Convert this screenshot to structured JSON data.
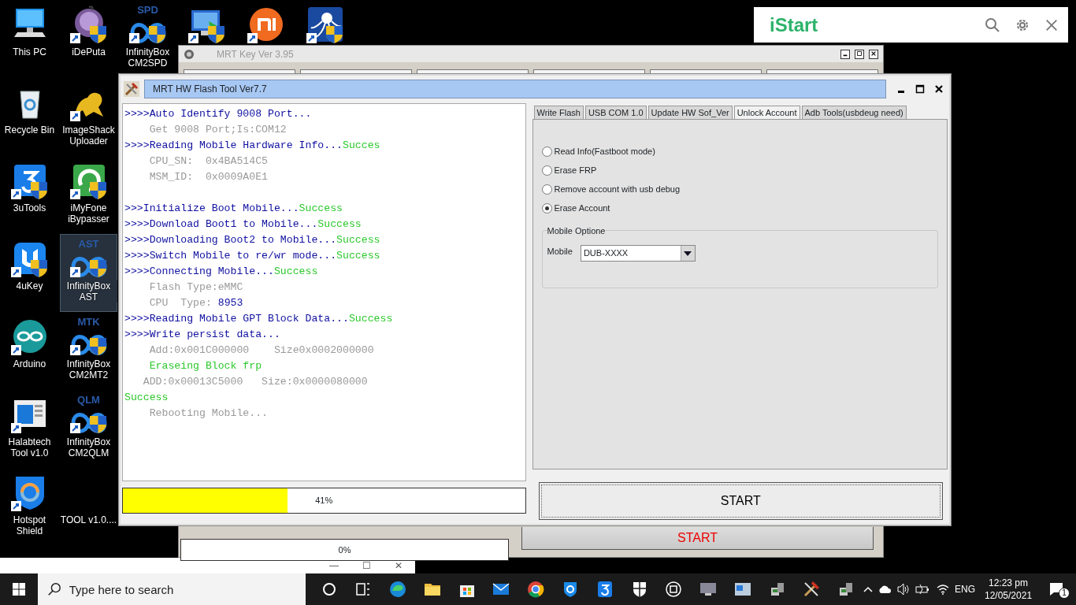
{
  "desktop": {
    "columns": [
      [
        {
          "label": "This PC",
          "kind": "pc",
          "shortcut": false,
          "shield": false,
          "selected": false
        },
        {
          "label": "Recycle Bin",
          "kind": "bin",
          "shortcut": false,
          "shield": false,
          "selected": false
        },
        {
          "label": "3uTools",
          "kind": "three",
          "shortcut": true,
          "shield": true,
          "selected": false
        },
        {
          "label": "4uKey",
          "kind": "key",
          "shortcut": true,
          "shield": true,
          "selected": false
        },
        {
          "label": "Arduino",
          "kind": "arduino",
          "shortcut": true,
          "shield": false,
          "selected": false
        },
        {
          "label": "Halabtech Tool v1.0",
          "kind": "window",
          "shortcut": true,
          "shield": false,
          "selected": false
        },
        {
          "label": "Hotspot Shield",
          "kind": "hotspot",
          "shortcut": true,
          "shield": false,
          "selected": false
        }
      ],
      [
        {
          "label": "iDePuta",
          "kind": "doll",
          "shortcut": true,
          "shield": true,
          "selected": false
        },
        {
          "label": "ImageShack Uploader",
          "kind": "frog",
          "shortcut": true,
          "shield": false,
          "selected": false
        },
        {
          "label": "iMyFone iBypasser",
          "kind": "bypass",
          "shortcut": true,
          "shield": true,
          "selected": false
        },
        {
          "label": "InfinityBox AST",
          "badge": "AST",
          "kind": "infinity",
          "shortcut": true,
          "shield": true,
          "selected": true
        },
        {
          "label": "InfinityBox CM2MT2",
          "badge": "MTK",
          "kind": "infinity",
          "shortcut": true,
          "shield": true,
          "selected": false
        },
        {
          "label": "InfinityBox CM2QLM",
          "badge": "QLM",
          "kind": "infinity",
          "shortcut": true,
          "shield": true,
          "selected": false
        },
        {
          "label": "TOOL v1.0....",
          "selected": false
        }
      ],
      [
        {
          "label": "InfinityBox CM2SPD",
          "badge": "SPD",
          "kind": "infinity",
          "shortcut": true,
          "shield": true,
          "selected": false
        }
      ],
      [
        {
          "kind": "monitor",
          "shortcut": true,
          "shield": true
        }
      ],
      [
        {
          "kind": "mi",
          "shortcut": true,
          "shield": false
        }
      ],
      [
        {
          "kind": "octopus",
          "shortcut": true,
          "shield": true
        }
      ]
    ]
  },
  "istart": {
    "title": "iStart"
  },
  "back_window": {
    "controls": [
      "—",
      "☐",
      "✕"
    ]
  },
  "mrt_key_window": {
    "title": "MRT Key Ver 3.95",
    "progress": {
      "level": 0,
      "label": "0%"
    },
    "start_button": "START"
  },
  "flash_window": {
    "title": "MRT HW Flash Tool Ver7.7",
    "log": [
      {
        "segments": [
          {
            "text": ">>>>Auto Identify 9008 Port...",
            "kind": "cmd"
          }
        ]
      },
      {
        "segments": [
          {
            "text": "    Get 9008 Port;Is:COM12",
            "kind": "info"
          }
        ]
      },
      {
        "segments": [
          {
            "text": ">>>>Reading Mobile Hardware Info...",
            "kind": "cmd"
          },
          {
            "text": "Succes",
            "kind": "ok"
          }
        ]
      },
      {
        "segments": [
          {
            "text": "    CPU_SN:  0x4BA514C5",
            "kind": "info"
          }
        ]
      },
      {
        "segments": [
          {
            "text": "    MSM_ID:  0x0009A0E1",
            "kind": "info"
          }
        ]
      },
      {
        "gap_before": true,
        "segments": [
          {
            "text": ">>>Initialize Boot Mobile...",
            "kind": "cmd"
          },
          {
            "text": "Success",
            "kind": "ok"
          }
        ]
      },
      {
        "segments": [
          {
            "text": ">>>>Download Boot1 to Mobile...",
            "kind": "cmd"
          },
          {
            "text": "Success",
            "kind": "ok"
          }
        ]
      },
      {
        "segments": [
          {
            "text": ">>>>Downloading Boot2 to Mobile...",
            "kind": "cmd"
          },
          {
            "text": "Success",
            "kind": "ok"
          }
        ]
      },
      {
        "segments": [
          {
            "text": ">>>>Switch Mobile to re/wr mode...",
            "kind": "cmd"
          },
          {
            "text": "Success",
            "kind": "ok"
          }
        ]
      },
      {
        "segments": [
          {
            "text": ">>>>Connecting Mobile...",
            "kind": "cmd"
          },
          {
            "text": "Success",
            "kind": "ok"
          }
        ]
      },
      {
        "segments": [
          {
            "text": "    Flash Type:eMMC",
            "kind": "info"
          }
        ]
      },
      {
        "segments": [
          {
            "text": "    CPU  Type: ",
            "kind": "info"
          },
          {
            "text": "8953",
            "kind": "cmd"
          }
        ]
      },
      {
        "segments": [
          {
            "text": ">>>>Reading Mobile GPT Block Data...",
            "kind": "cmd"
          },
          {
            "text": "Success",
            "kind": "ok"
          }
        ]
      },
      {
        "segments": [
          {
            "text": ">>>>Write persist data...",
            "kind": "cmd"
          }
        ]
      },
      {
        "segments": [
          {
            "text": "    Add:0x001C000000    Size0x0002000000",
            "kind": "info"
          }
        ]
      },
      {
        "segments": [
          {
            "text": "    Eraseing Block frp",
            "kind": "ok"
          }
        ]
      },
      {
        "segments": [
          {
            "text": "   ADD:0x00013C5000   Size:0x0000080000",
            "kind": "info"
          }
        ]
      },
      {
        "segments": [
          {
            "text": "Success",
            "kind": "ok"
          }
        ]
      },
      {
        "segments": [
          {
            "text": "    Rebooting Mobile...",
            "kind": "info"
          }
        ]
      }
    ],
    "progress": {
      "level": 0.41,
      "label": "41%"
    },
    "tabs": [
      {
        "label": "Write Flash",
        "selected": false
      },
      {
        "label": "USB COM 1.0",
        "selected": false
      },
      {
        "label": "Update HW Sof_Ver",
        "selected": false
      },
      {
        "label": "Unlock Account",
        "selected": true
      },
      {
        "label": "Adb Tools(usbdeug need)",
        "selected": false
      }
    ],
    "options": [
      {
        "label": "Read Info(Fastboot mode)",
        "selected": false
      },
      {
        "label": "Erase FRP",
        "selected": false
      },
      {
        "label": "Remove account with usb debug",
        "selected": false
      },
      {
        "label": "Erase Account",
        "selected": true
      }
    ],
    "group": {
      "title": "Mobile Optione",
      "field_label": "Mobile",
      "value": "DUB-XXXX"
    },
    "start_button": "START"
  },
  "taskbar": {
    "search_placeholder": "Type here to search",
    "apps": [
      {
        "kind": "cortana"
      },
      {
        "kind": "taskview"
      },
      {
        "kind": "browser"
      },
      {
        "kind": "folder"
      },
      {
        "kind": "store"
      },
      {
        "kind": "mail"
      },
      {
        "kind": "chrome"
      },
      {
        "kind": "shieldapp"
      },
      {
        "kind": "three"
      },
      {
        "kind": "security"
      },
      {
        "kind": "snip"
      },
      {
        "kind": "monitorapp"
      },
      {
        "kind": "card"
      },
      {
        "kind": "pcapp"
      },
      {
        "kind": "tools"
      },
      {
        "kind": "pcapp"
      }
    ],
    "language": "ENG",
    "time": "12:23 pm",
    "date": "12/05/2021",
    "notifications": "1"
  }
}
